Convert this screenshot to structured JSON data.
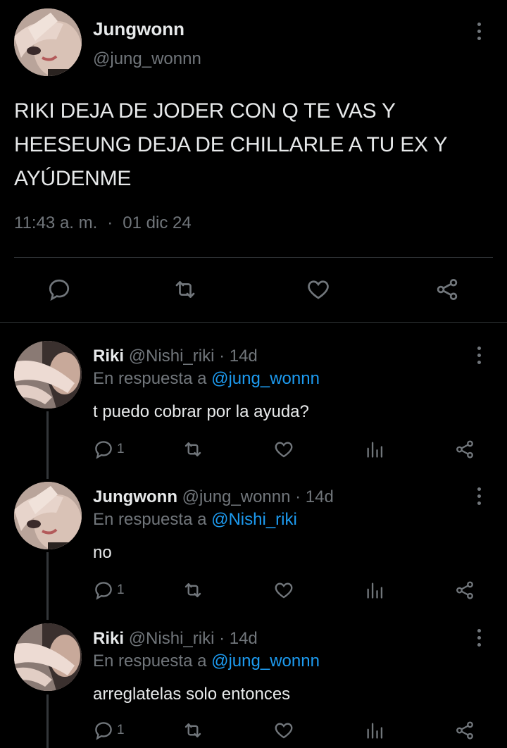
{
  "main_tweet": {
    "author_name": "Jungwonn",
    "author_handle": "@jung_wonnn",
    "text": "RIKI DEJA DE JODER CON Q TE VAS Y HEESEUNG DEJA DE CHILLARLE A TU EX Y AYÚDENME",
    "time": "11:43 a. m.",
    "separator": "·",
    "date": "01 dic 24"
  },
  "replies": [
    {
      "author_name": "Riki",
      "author_handle": "@Nishi_riki",
      "age": "· 14d",
      "reply_prefix": "En respuesta a",
      "reply_to": "@jung_wonnn",
      "text": "t puedo cobrar por la ayuda?",
      "reply_count": "1"
    },
    {
      "author_name": "Jungwonn",
      "author_handle": "@jung_wonnn",
      "age": "· 14d",
      "reply_prefix": "En respuesta a",
      "reply_to": "@Nishi_riki",
      "text": "no",
      "reply_count": "1"
    },
    {
      "author_name": "Riki",
      "author_handle": "@Nishi_riki",
      "age": "· 14d",
      "reply_prefix": "En respuesta a",
      "reply_to": "@jung_wonnn",
      "text": "arreglatelas solo entonces",
      "reply_count": "1"
    }
  ],
  "icons": {
    "reply": "reply-icon",
    "retweet": "retweet-icon",
    "like": "heart-icon",
    "views": "analytics-icon",
    "share": "share-icon",
    "more": "more-icon"
  },
  "colors": {
    "background": "#000000",
    "text": "#e7e9ea",
    "secondary": "#71767b",
    "link": "#1d9bf0",
    "divider": "#2f3336"
  }
}
